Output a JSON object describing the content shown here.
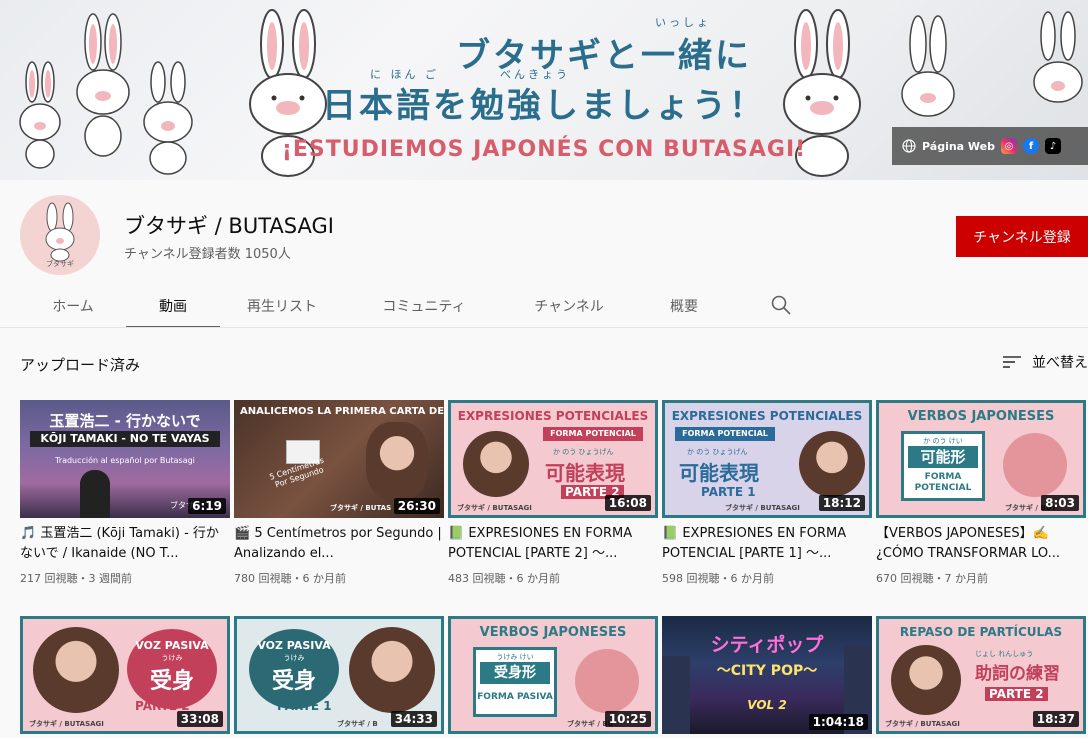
{
  "banner": {
    "line1": "ブタサギと一緒に",
    "line1_ruby_a": "いっしょ",
    "line2": "日本語を勉強しましょう！",
    "line2_ruby_a": "に ほん ご",
    "line2_ruby_b": "べんきょう",
    "line3": "¡ESTUDIEMOS JAPONÉS CON BUTASAGI!",
    "link_label": "Página Web"
  },
  "channel": {
    "name": "ブタサギ / BUTASAGI",
    "subscribers": "チャンネル登録者数 1050人",
    "subscribe_label": "チャンネル登録",
    "avatar_caption": "ブタサギ"
  },
  "tabs": [
    {
      "label": "ホーム"
    },
    {
      "label": "動画"
    },
    {
      "label": "再生リスト"
    },
    {
      "label": "コミュニティ"
    },
    {
      "label": "チャンネル"
    },
    {
      "label": "概要"
    }
  ],
  "section": {
    "title": "アップロード済み",
    "sort_label": "並べ替え"
  },
  "colors": {
    "accent_teal": "#2a6d8c",
    "subscribe_red": "#cc0000",
    "pink": "#e4949b"
  },
  "videos": [
    {
      "duration": "6:19",
      "title": "🎵 玉置浩二 (Kōji Tamaki) - 行かないで / Ikanaide (NO T...",
      "meta": "217 回視聴・3 週間前",
      "t1": "玉置浩二 - 行かないで",
      "t2": "KŌJI TAMAKI - NO TE VAYAS",
      "t3": "Traducción al español por Butasagi",
      "t4": "ブタサ"
    },
    {
      "duration": "26:30",
      "title": "🎬 5 Centímetros por Segundo | Analizando el...",
      "meta": "780 回視聴・6 か月前",
      "t1": "ANALICEMOS LA PRIMERA CARTA DE:",
      "t2": "5 Centímetros Por Segundo",
      "t3": "ブタサギ / BUTAS"
    },
    {
      "duration": "16:08",
      "title": "📗 EXPRESIONES EN FORMA POTENCIAL [PARTE 2] ～...",
      "meta": "483 回視聴・6 か月前",
      "t1": "EXPRESIONES POTENCIALES",
      "t2": "FORMA POTENCIAL",
      "t3": "可能表現",
      "t4": "PARTE 2",
      "t5": "ブタサギ / BUTASAGI",
      "ruby": "か のう ひょうげん"
    },
    {
      "duration": "18:12",
      "title": "📗 EXPRESIONES EN FORMA POTENCIAL [PARTE 1] ～...",
      "meta": "598 回視聴・6 か月前",
      "t1": "EXPRESIONES POTENCIALES",
      "t2": "FORMA POTENCIAL",
      "t3": "可能表現",
      "t4": "PARTE 1",
      "t5": "ブタサギ / BUTASAGI",
      "ruby": "か のう ひょうげん"
    },
    {
      "duration": "8:03",
      "title": "【VERBOS JAPONESES】✍️ ¿CÓMO TRANSFORMAR LO...",
      "meta": "670 回視聴・7 か月前",
      "t1": "VERBOS JAPONESES",
      "t2": "可能形",
      "t3": "FORMA POTENCIAL",
      "t4": "ブタサギ / BUT",
      "ruby": "か のう けい"
    },
    {
      "duration": "33:08",
      "t1": "VOZ PASIVA",
      "t2": "受身",
      "t3": "PARTE 2",
      "t4": "ブタサギ / BUTASAGI",
      "ruby": "うけみ"
    },
    {
      "duration": "34:33",
      "t1": "VOZ PASIVA",
      "t2": "受身",
      "t3": "PARTE 1",
      "t4": "ブタサギ / B",
      "ruby": "うけみ"
    },
    {
      "duration": "10:25",
      "t1": "VERBOS JAPONESES",
      "t2": "受身形",
      "t3": "FORMA PASIVA",
      "t4": "ブタサギ / BU",
      "ruby": "うけみ けい"
    },
    {
      "duration": "1:04:18",
      "t1": "シティポップ",
      "t2": "〜CITY POP〜",
      "t3": "VOL 2"
    },
    {
      "duration": "18:37",
      "t1": "REPASO DE PARTÍCULAS",
      "t2": "助詞の練習",
      "t3": "PARTE 2",
      "t4": "ブタサギ / BUTASAGI",
      "ruby": "じょし     れんしゅう"
    }
  ]
}
